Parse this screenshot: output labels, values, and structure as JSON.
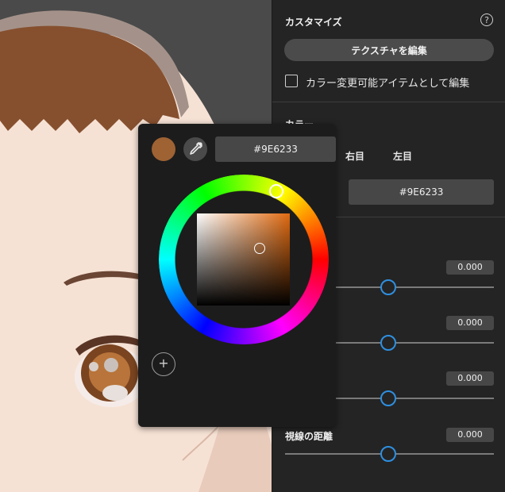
{
  "panel": {
    "customize_title": "カスタマイズ",
    "help_icon": "question-circle-icon",
    "edit_texture_label": "テクスチャを編集",
    "color_editable_label": "カラー変更可能アイテムとして編集",
    "color_section_title": "カラー",
    "tabs": [
      "右目",
      "左目"
    ],
    "hex_value": "#9E6233",
    "sliders": [
      {
        "label": "",
        "value": "0.000",
        "level": 0.5
      },
      {
        "label": "",
        "value": "0.000",
        "level": 0.5
      },
      {
        "label": "",
        "value": "0.000",
        "level": 0.5
      },
      {
        "label": "視線の距離",
        "value": "0.000",
        "level": 0.5
      }
    ]
  },
  "picker": {
    "current_color": "#9E6233",
    "hex_value": "#9E6233",
    "eyedropper_icon": "eyedropper-icon",
    "add_icon": "plus-icon",
    "add_symbol": "+"
  },
  "colors": {
    "accent": "#2E8FE0",
    "panel_bg": "#242424",
    "picker_bg": "#1C1C1C",
    "hair": "#8A4E2C",
    "skin": "#F7E3D6"
  }
}
